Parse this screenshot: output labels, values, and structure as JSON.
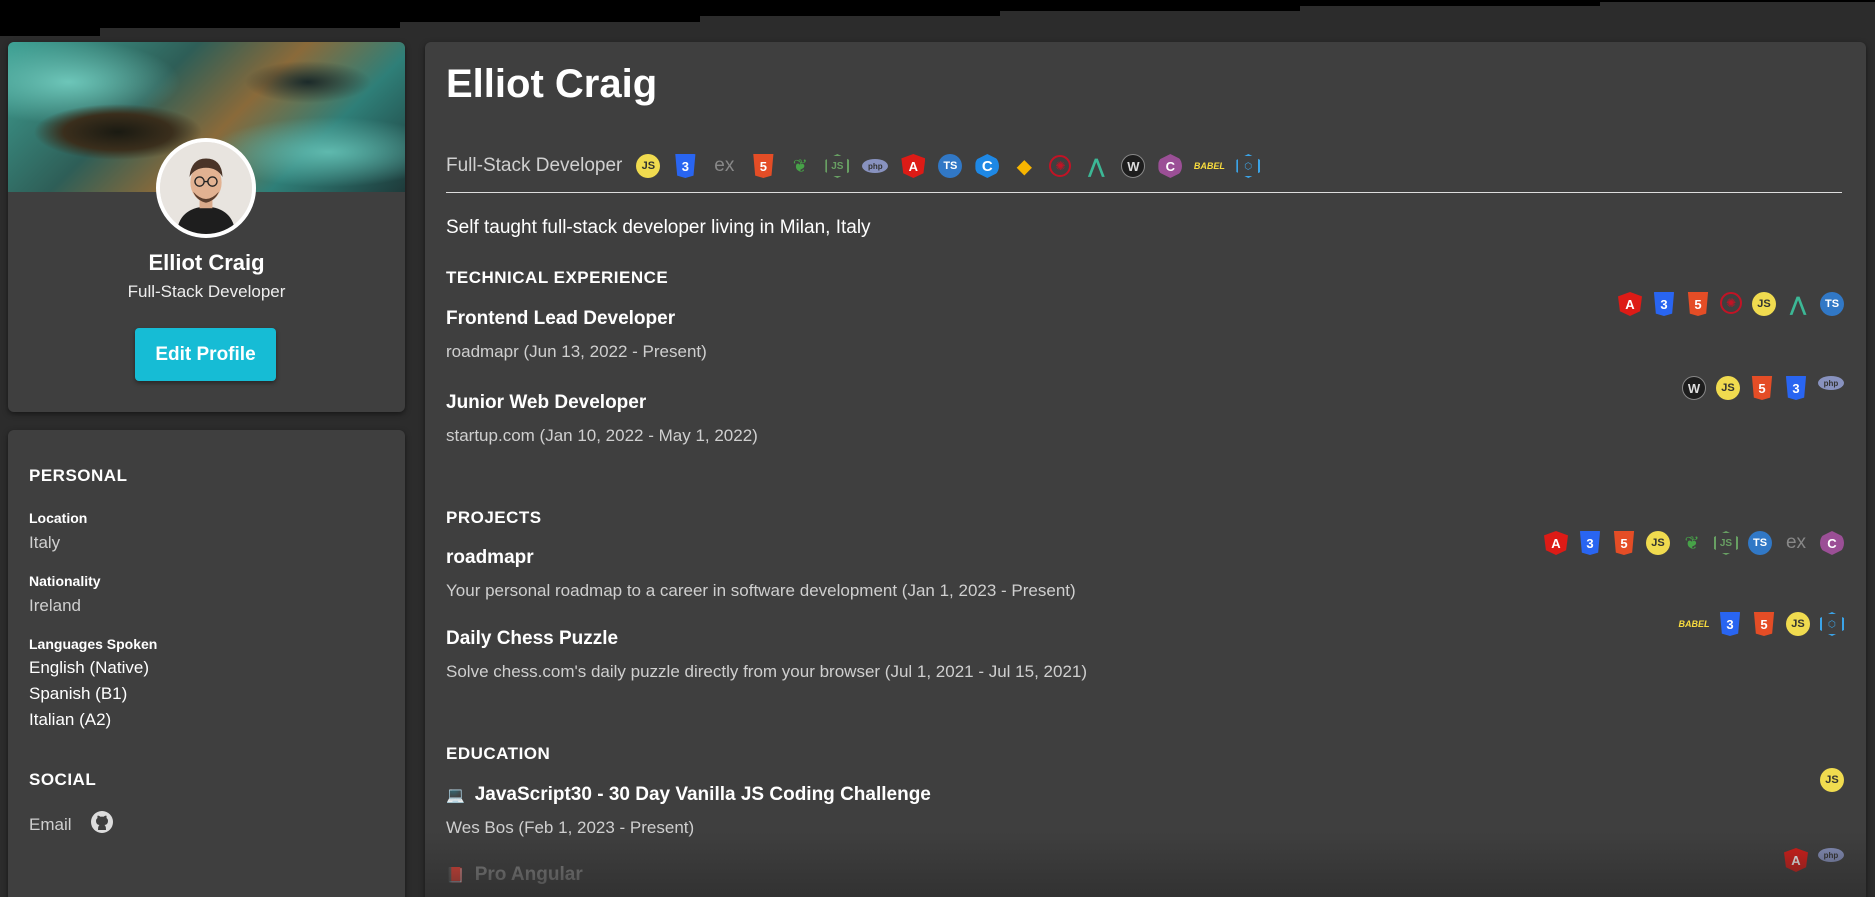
{
  "profile": {
    "name": "Elliot Craig",
    "role": "Full-Stack Developer",
    "edit_label": "Edit Profile"
  },
  "personal": {
    "heading": "PERSONAL",
    "location_label": "Location",
    "location": "Italy",
    "nationality_label": "Nationality",
    "nationality": "Ireland",
    "languages_label": "Languages Spoken",
    "languages": [
      "English (Native)",
      "Spanish (B1)",
      "Italian (A2)"
    ]
  },
  "social": {
    "heading": "SOCIAL",
    "email_label": "Email",
    "github_icon": "github-icon"
  },
  "main": {
    "name": "Elliot Craig",
    "role": "Full-Stack Developer",
    "bio": "Self taught full-stack developer living in Milan, Italy",
    "skills": [
      "js",
      "css",
      "ex",
      "html",
      "mongo",
      "node",
      "php",
      "ng",
      "ts",
      "c",
      "sketch",
      "graph",
      "nuxt",
      "wp",
      "cs",
      "babel",
      "ng2"
    ]
  },
  "experience": {
    "heading": "TECHNICAL EXPERIENCE",
    "items": [
      {
        "title": "Frontend Lead Developer",
        "sub": "roadmapr (Jun 13, 2022 - Present)",
        "icons": [
          "ng",
          "css",
          "html",
          "graph",
          "js",
          "nuxt",
          "ts"
        ]
      },
      {
        "title": "Junior Web Developer",
        "sub": "startup.com (Jan 10, 2022 - May 1, 2022)",
        "icons": [
          "wp",
          "js",
          "html",
          "css",
          "php"
        ]
      }
    ]
  },
  "projects": {
    "heading": "PROJECTS",
    "items": [
      {
        "title": "roadmapr",
        "sub": "Your personal roadmap to a career in software development (Jan 1, 2023 - Present)",
        "icons": [
          "ng",
          "css",
          "html",
          "js",
          "mongo",
          "node",
          "ts",
          "ex",
          "cs"
        ]
      },
      {
        "title": "Daily Chess Puzzle",
        "sub": "Solve chess.com's daily puzzle directly from your browser (Jul 1, 2021 - Jul 15, 2021)",
        "icons": [
          "babel",
          "css",
          "html",
          "js",
          "ng2"
        ]
      }
    ]
  },
  "education": {
    "heading": "EDUCATION",
    "items": [
      {
        "title": "JavaScript30 - 30 Day Vanilla JS Coding Challenge",
        "sub": "Wes Bos (Feb 1, 2023 - Present)",
        "icons": [
          "js"
        ]
      },
      {
        "title": "Pro Angular",
        "sub": "",
        "icons": [
          "ng",
          "php"
        ]
      }
    ]
  },
  "icon_glyphs": {
    "js": "JS",
    "css": "3",
    "ex": "ex",
    "html": "5",
    "mongo": "❦",
    "node": "JS",
    "php": "php",
    "ng": "A",
    "ts": "TS",
    "c": "C",
    "sketch": "◆",
    "graph": "✺",
    "nuxt": "⋀",
    "wp": "W",
    "cs": "C",
    "babel": "BABEL",
    "ng2": "⬡"
  },
  "colors": {
    "accent": "#16bcd5",
    "card": "#3f3f3f",
    "bg": "#2c2c2c"
  }
}
